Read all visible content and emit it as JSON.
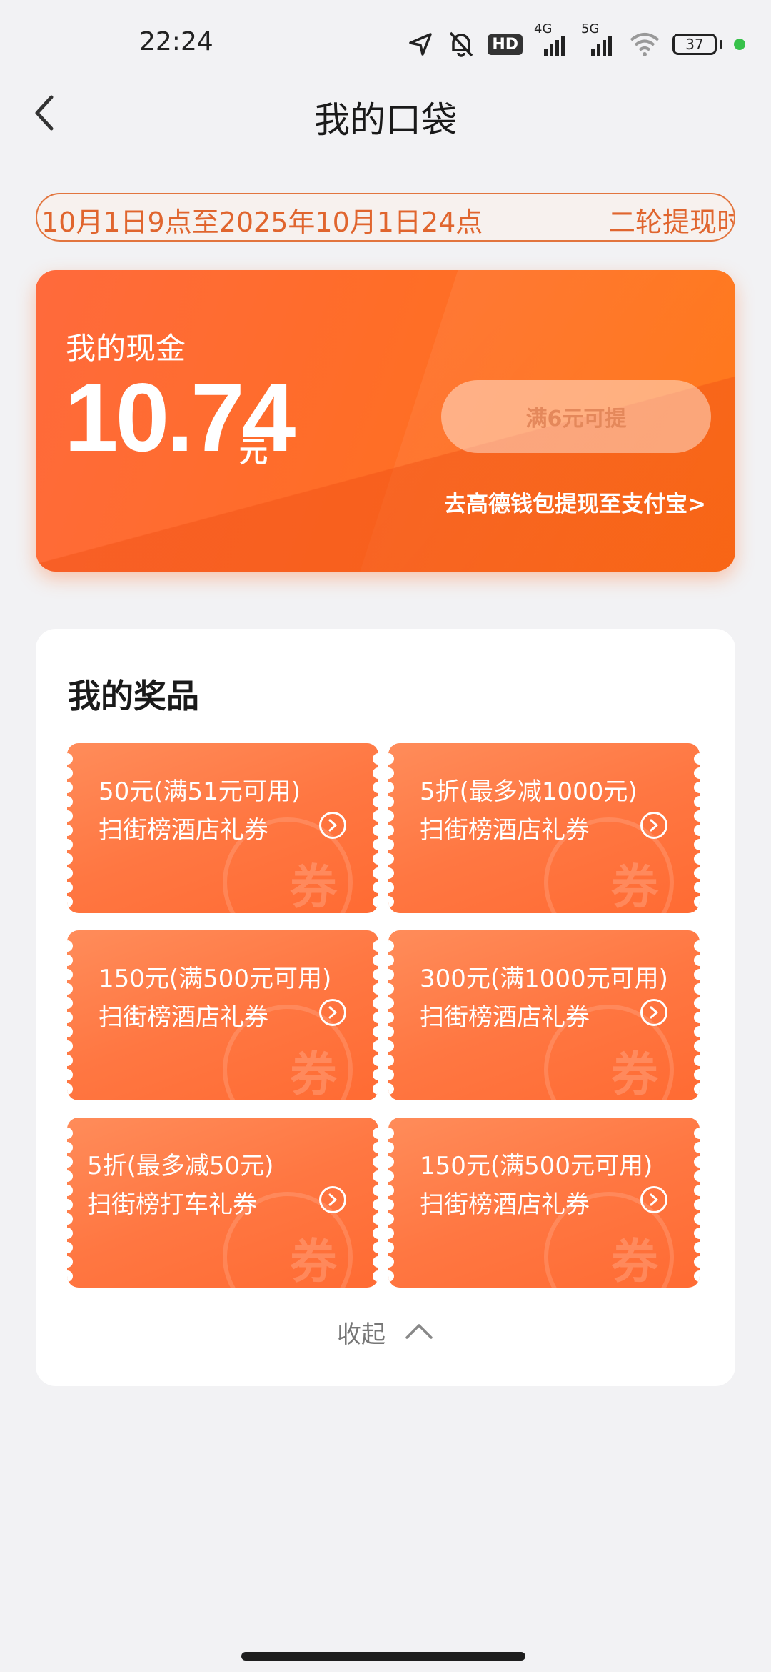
{
  "status_bar": {
    "time": "22:24",
    "network1": "4G",
    "network2": "5G",
    "hd_badge": "HD",
    "battery": "37",
    "icons": [
      "location-icon",
      "silent-bell-icon",
      "hd-icon",
      "signal-4g-icon",
      "signal-5g-icon",
      "wifi-icon",
      "battery-icon",
      "green-dot-icon"
    ]
  },
  "header": {
    "title": "我的口袋",
    "back_icon": "chevron-left-icon"
  },
  "marquee": {
    "left_text": "10月1日9点至2025年10月1日24点",
    "right_text": "二轮提现时"
  },
  "cash": {
    "label": "我的现金",
    "amount": "10.74",
    "unit": "元",
    "withdraw_button": "满6元可提",
    "alipay_link": "去高德钱包提现至支付宝>"
  },
  "prizes": {
    "title": "我的奖品",
    "coupon_watermark": "券",
    "items": [
      {
        "line1": "50元(满51元可用)",
        "line2": "扫街榜酒店礼券"
      },
      {
        "line1": "5折(最多减1000元)",
        "line2": "扫街榜酒店礼券"
      },
      {
        "line1": "150元(满500元可用)",
        "line2": "扫街榜酒店礼券"
      },
      {
        "line1": "300元(满1000元可用)",
        "line2": "扫街榜酒店礼券"
      },
      {
        "line1": "5折(最多减50元)",
        "line2": "扫街榜打车礼券"
      },
      {
        "line1": "150元(满500元可用)",
        "line2": "扫街榜酒店礼券"
      }
    ],
    "collapse_label": "收起"
  },
  "colors": {
    "accent": "#ff6d28",
    "page_bg": "#f2f2f4",
    "marquee_text": "#e0652e"
  }
}
